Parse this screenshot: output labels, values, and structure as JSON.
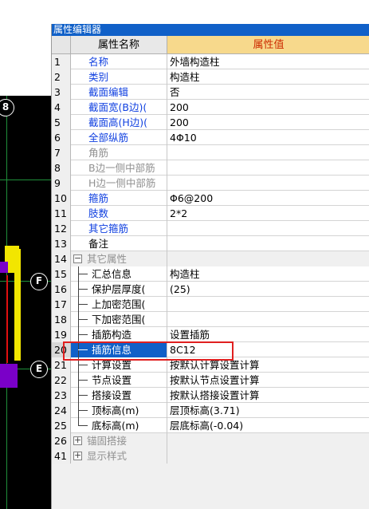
{
  "canvas": {
    "axis_labels": [
      "8",
      "F",
      "E"
    ]
  },
  "panel": {
    "title": "属性编辑器",
    "col_name_header": "属性名称",
    "col_value_header": "属性值"
  },
  "rows": [
    {
      "num": "1",
      "name": "名称",
      "value": "外墙构造柱"
    },
    {
      "num": "2",
      "name": "类别",
      "value": "构造柱"
    },
    {
      "num": "3",
      "name": "截面编辑",
      "value": "否"
    },
    {
      "num": "4",
      "name": "截面宽(B边)(",
      "value": "200"
    },
    {
      "num": "5",
      "name": "截面高(H边)(",
      "value": "200"
    },
    {
      "num": "6",
      "name": "全部纵筋",
      "value": "4Φ10"
    },
    {
      "num": "7",
      "name": "角筋",
      "value": ""
    },
    {
      "num": "8",
      "name": "B边一侧中部筋",
      "value": ""
    },
    {
      "num": "9",
      "name": "H边一侧中部筋",
      "value": ""
    },
    {
      "num": "10",
      "name": "箍筋",
      "value": "Φ6@200"
    },
    {
      "num": "11",
      "name": "肢数",
      "value": "2*2"
    },
    {
      "num": "12",
      "name": "其它箍筋",
      "value": ""
    },
    {
      "num": "13",
      "name": "备注",
      "value": ""
    },
    {
      "num": "14",
      "name": "其它属性",
      "value": ""
    },
    {
      "num": "15",
      "name": "汇总信息",
      "value": "构造柱"
    },
    {
      "num": "16",
      "name": "保护层厚度(",
      "value": "(25)"
    },
    {
      "num": "17",
      "name": "上加密范围(",
      "value": ""
    },
    {
      "num": "18",
      "name": "下加密范围(",
      "value": ""
    },
    {
      "num": "19",
      "name": "插筋构造",
      "value": "设置插筋"
    },
    {
      "num": "20",
      "name": "插筋信息",
      "value": "8C12"
    },
    {
      "num": "21",
      "name": "计算设置",
      "value": "按默认计算设置计算"
    },
    {
      "num": "22",
      "name": "节点设置",
      "value": "按默认节点设置计算"
    },
    {
      "num": "23",
      "name": "搭接设置",
      "value": "按默认搭接设置计算"
    },
    {
      "num": "24",
      "name": "顶标高(m)",
      "value": "层顶标高(3.71)"
    },
    {
      "num": "25",
      "name": "底标高(m)",
      "value": "层底标高(-0.04)"
    },
    {
      "num": "26",
      "name": "锚固搭接",
      "value": ""
    },
    {
      "num": "41",
      "name": "显示样式",
      "value": ""
    }
  ],
  "expander_plus": "+",
  "expander_minus": "−",
  "colors": {
    "title_bar": "#1060c8",
    "value_header": "#f7d98c",
    "blue_label": "#1040e0",
    "highlight_box": "#e02020"
  }
}
